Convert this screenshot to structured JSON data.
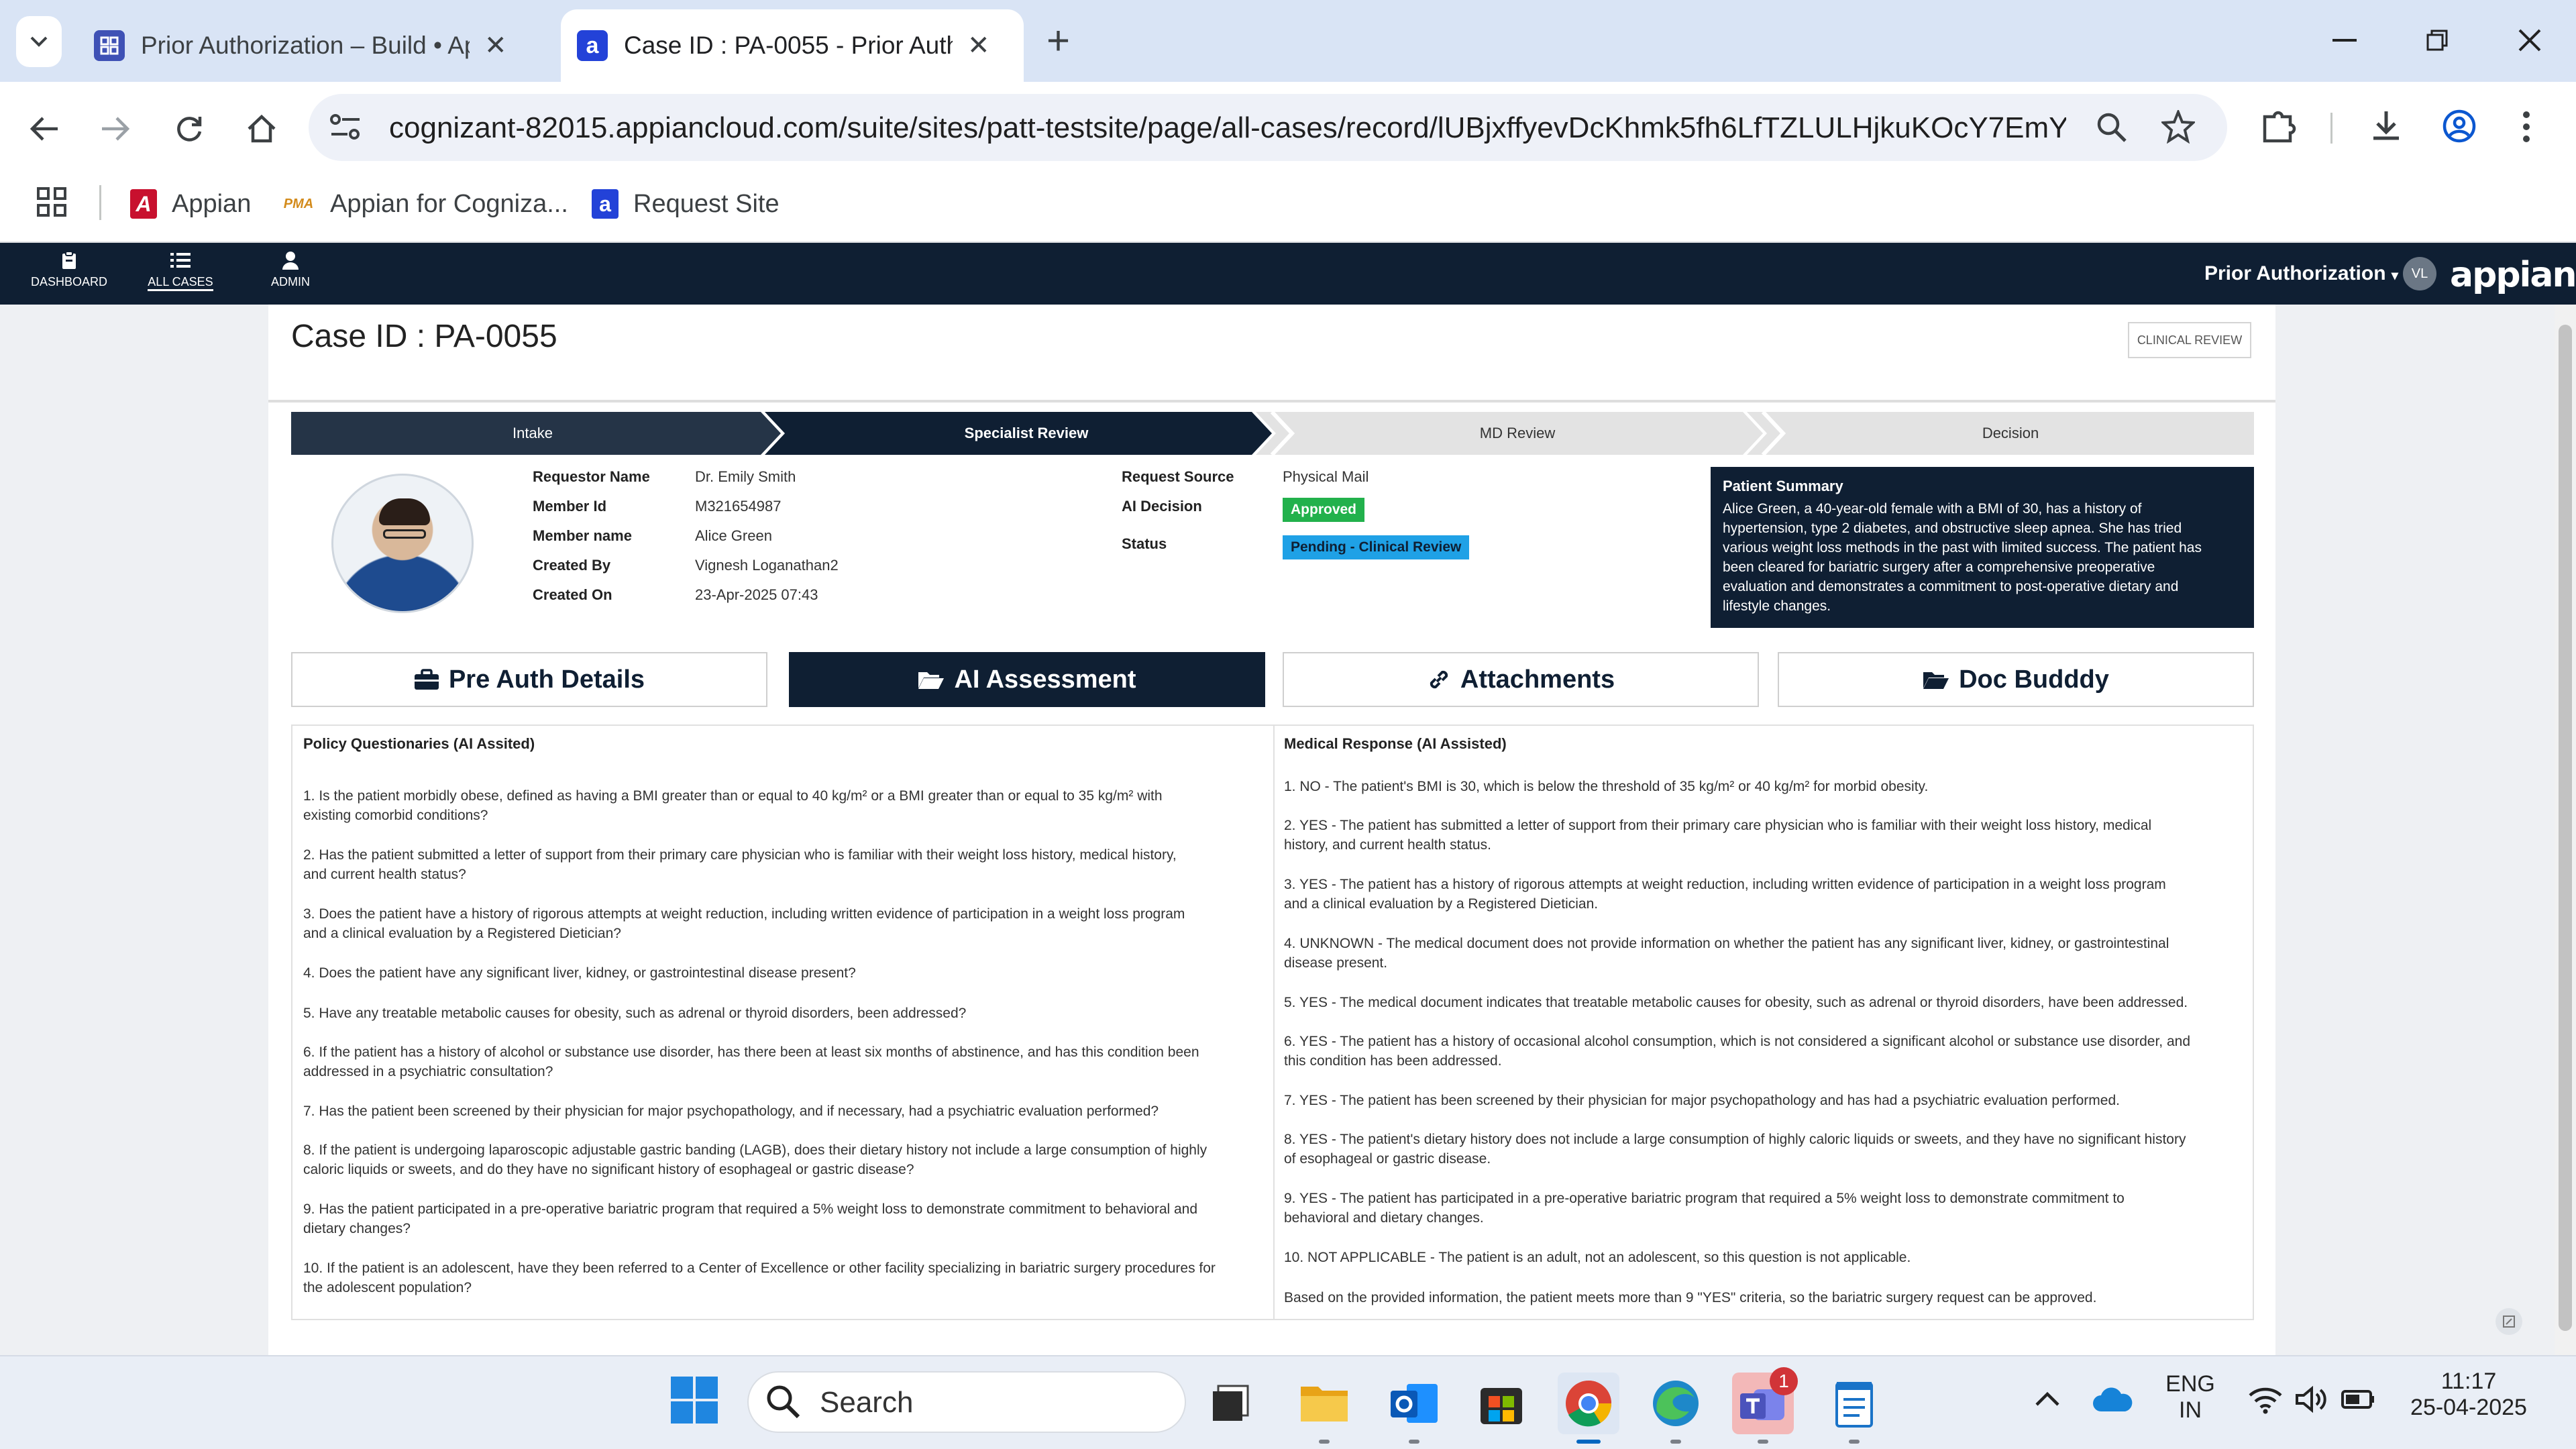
{
  "browser": {
    "tabs": [
      {
        "title": "Prior Authorization – Build • Ap",
        "favicon": "grid-app-icon",
        "active": false
      },
      {
        "title": "Case ID : PA-0055 - Prior Autho",
        "favicon": "appian-a-icon",
        "active": true
      }
    ],
    "url": "cognizant-82015.appiancloud.com/suite/sites/patt-testsite/page/all-cases/record/lUBjxffyevDcKhmk5fh6LfTZLULHjkuKOcY7EmY_7Tta...",
    "bookmarks": [
      {
        "label": "Appian",
        "icon": "appian-logo-icon"
      },
      {
        "label": "Appian for Cogniza...",
        "icon": "pma-logo-icon"
      },
      {
        "label": "Request Site",
        "icon": "appian-a-icon"
      }
    ],
    "colors": {
      "tabstrip": "#d9e4f5",
      "accent": "#0b57d0"
    }
  },
  "appian": {
    "nav": [
      {
        "label": "DASHBOARD",
        "icon": "clipboard-icon"
      },
      {
        "label": "ALL CASES",
        "icon": "list-icon",
        "active": true
      },
      {
        "label": "ADMIN",
        "icon": "user-icon"
      }
    ],
    "app_name": "Prior Authorization",
    "avatar_initials": "VL",
    "logo": "appian",
    "colors": {
      "header": "#0f1f33",
      "approved": "#22b14c",
      "pending": "#1fa1e6"
    }
  },
  "case": {
    "title": "Case ID : PA-0055",
    "action_button": "CLINICAL REVIEW",
    "steps": [
      {
        "label": "Intake",
        "state": "done"
      },
      {
        "label": "Specialist Review",
        "state": "current"
      },
      {
        "label": "MD Review",
        "state": "todo"
      },
      {
        "label": "Decision",
        "state": "todo"
      }
    ],
    "details_left": [
      {
        "label": "Requestor Name",
        "value": "Dr. Emily Smith"
      },
      {
        "label": "Member Id",
        "value": "M321654987"
      },
      {
        "label": "Member name",
        "value": "Alice Green"
      },
      {
        "label": "Created By",
        "value": "Vignesh Loganathan2"
      },
      {
        "label": "Created On",
        "value": "23-Apr-2025 07:43"
      }
    ],
    "details_right": {
      "request_source_label": "Request Source",
      "request_source": "Physical Mail",
      "ai_decision_label": "AI Decision",
      "ai_decision": "Approved",
      "status_label": "Status",
      "status": "Pending - Clinical Review"
    },
    "summary": {
      "title": "Patient Summary",
      "lines": [
        "Alice Green, a 40-year-old female with a BMI of 30, has a history of",
        "hypertension, type 2 diabetes, and obstructive sleep apnea. She has tried",
        "various weight loss methods in the past with limited success. The patient has",
        "been cleared for bariatric surgery after a comprehensive preoperative",
        "evaluation and demonstrates a commitment to post-operative dietary and",
        "lifestyle changes."
      ]
    },
    "tabs": [
      {
        "label": "Pre Auth Details",
        "icon": "briefcase-icon"
      },
      {
        "label": "AI Assessment",
        "icon": "folder-open-icon",
        "active": true
      },
      {
        "label": "Attachments",
        "icon": "link-icon"
      },
      {
        "label": "Doc Budddy",
        "icon": "folder-open-icon"
      }
    ],
    "questions_header": "Policy Questionaries (AI Assited)",
    "responses_header": "Medical Response (AI Assisted)",
    "questions": [
      [
        "1. Is the patient morbidly obese, defined as having a BMI greater than or equal to 40 kg/m² or a BMI greater than or equal to 35 kg/m² with",
        "existing comorbid conditions?"
      ],
      [
        "2. Has the patient submitted a letter of support from their primary care physician who is familiar with their weight loss history, medical history,",
        "and current health status?"
      ],
      [
        "3. Does the patient have a history of rigorous attempts at weight reduction, including written evidence of participation in a weight loss program",
        "and a clinical evaluation by a Registered Dietician?"
      ],
      [
        "4. Does the patient have any significant liver, kidney, or gastrointestinal disease present?"
      ],
      [
        "5. Have any treatable metabolic causes for obesity, such as adrenal or thyroid disorders, been addressed?"
      ],
      [
        "6. If the patient has a history of alcohol or substance use disorder, has there been at least six months of abstinence, and has this condition been",
        "addressed in a psychiatric consultation?"
      ],
      [
        "7. Has the patient been screened by their physician for major psychopathology, and if necessary, had a psychiatric evaluation performed?"
      ],
      [
        "8. If the patient is undergoing laparoscopic adjustable gastric banding (LAGB), does their dietary history not include a large consumption of highly",
        "caloric liquids or sweets, and do they have no significant history of esophageal or gastric disease?"
      ],
      [
        "9. Has the patient participated in a pre-operative bariatric program that required a 5% weight loss to demonstrate commitment to behavioral and",
        "dietary changes?"
      ],
      [
        "10. If the patient is an adolescent, have they been referred to a Center of Excellence or other facility specializing in bariatric surgery procedures for",
        "the adolescent population?"
      ]
    ],
    "responses": [
      [
        "1. NO - The patient's BMI is 30, which is below the threshold of 35 kg/m² or 40 kg/m² for morbid obesity."
      ],
      [
        "2. YES - The patient has submitted a letter of support from their primary care physician who is familiar with their weight loss history, medical",
        "history, and current health status."
      ],
      [
        "3. YES - The patient has a history of rigorous attempts at weight reduction, including written evidence of participation in a weight loss program",
        "and a clinical evaluation by a Registered Dietician."
      ],
      [
        "4. UNKNOWN - The medical document does not provide information on whether the patient has any significant liver, kidney, or gastrointestinal",
        "disease present."
      ],
      [
        "5. YES - The medical document indicates that treatable metabolic causes for obesity, such as adrenal or thyroid disorders, have been addressed."
      ],
      [
        "6. YES - The patient has a history of occasional alcohol consumption, which is not considered a significant alcohol or substance use disorder, and",
        "this condition has been addressed."
      ],
      [
        "7. YES - The patient has been screened by their physician for major psychopathology and has had a psychiatric evaluation performed."
      ],
      [
        "8. YES - The patient's dietary history does not include a large consumption of highly caloric liquids or sweets, and they have no significant history",
        "of esophageal or gastric disease."
      ],
      [
        "9. YES - The patient has participated in a pre-operative bariatric program that required a 5% weight loss to demonstrate commitment to",
        "behavioral and dietary changes."
      ],
      [
        "10. NOT APPLICABLE - The patient is an adult, not an adolescent, so this question is not applicable."
      ],
      [
        "Based on the provided information, the patient meets more than 9 \"YES\" criteria, so the bariatric surgery request can be approved."
      ]
    ]
  },
  "taskbar": {
    "search_label": "Search",
    "teams_badge": "1",
    "lang_line1": "ENG",
    "lang_line2": "IN",
    "time": "11:17",
    "date": "25-04-2025"
  }
}
